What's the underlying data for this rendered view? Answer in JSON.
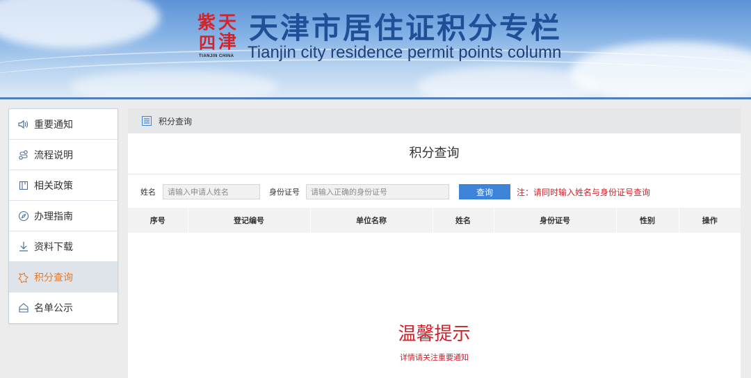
{
  "header": {
    "seal_chars": [
      "天",
      "津",
      "紫",
      "四"
    ],
    "seal_caption": "TIANJIN CHINA",
    "title": "天津市居住证积分专栏",
    "subtitle": "Tianjin city residence permit points column"
  },
  "sidebar": {
    "items": [
      {
        "label": "重要通知",
        "icon": "speaker-icon",
        "active": false
      },
      {
        "label": "流程说明",
        "icon": "flow-icon",
        "active": false
      },
      {
        "label": "相关政策",
        "icon": "building-icon",
        "active": false
      },
      {
        "label": "办理指南",
        "icon": "compass-icon",
        "active": false
      },
      {
        "label": "资料下载",
        "icon": "download-icon",
        "active": false
      },
      {
        "label": "积分查询",
        "icon": "query-icon",
        "active": true
      },
      {
        "label": "名单公示",
        "icon": "home-icon",
        "active": false
      }
    ]
  },
  "panel": {
    "breadcrumb": "积分查询",
    "title": "积分查询",
    "search": {
      "name_label": "姓名",
      "name_placeholder": "请输入申请人姓名",
      "id_label": "身份证号",
      "id_placeholder": "请输入正确的身份证号",
      "query_button": "查询",
      "note": "注：请同时输入姓名与身份证号查询"
    },
    "table": {
      "columns": [
        "序号",
        "登记编号",
        "单位名称",
        "姓名",
        "身份证号",
        "性别",
        "操作"
      ]
    },
    "tip": {
      "title": "温馨提示",
      "subtitle": "详情请关注重要通知"
    }
  },
  "colors": {
    "brand_blue": "#1f4f96",
    "accent_red": "#d0202a",
    "active_orange": "#e07a2e",
    "button_blue": "#3d84d8"
  }
}
